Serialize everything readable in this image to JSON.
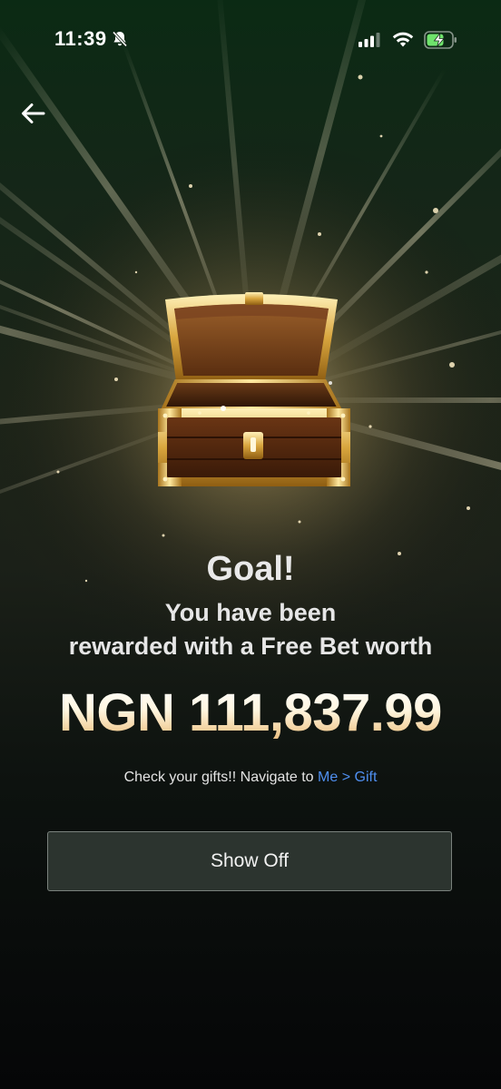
{
  "status_bar": {
    "time": "11:39",
    "icons": [
      "bell-slash-icon",
      "signal-icon",
      "wifi-icon",
      "battery-charging-icon"
    ]
  },
  "nav": {
    "back_icon": "arrow-left-icon"
  },
  "hero": {
    "icon": "treasure-chest-icon"
  },
  "reward": {
    "title": "Goal!",
    "line1": "You have been",
    "line2": "rewarded with a Free Bet worth",
    "amount": "NGN 111,837.99"
  },
  "hint": {
    "prefix": "Check your gifts!! Navigate to ",
    "link": "Me > Gift"
  },
  "actions": {
    "show_off_label": "Show Off"
  },
  "colors": {
    "link": "#4f8ff0",
    "gold": "#e9b878",
    "button_bg": "#2c342f"
  }
}
